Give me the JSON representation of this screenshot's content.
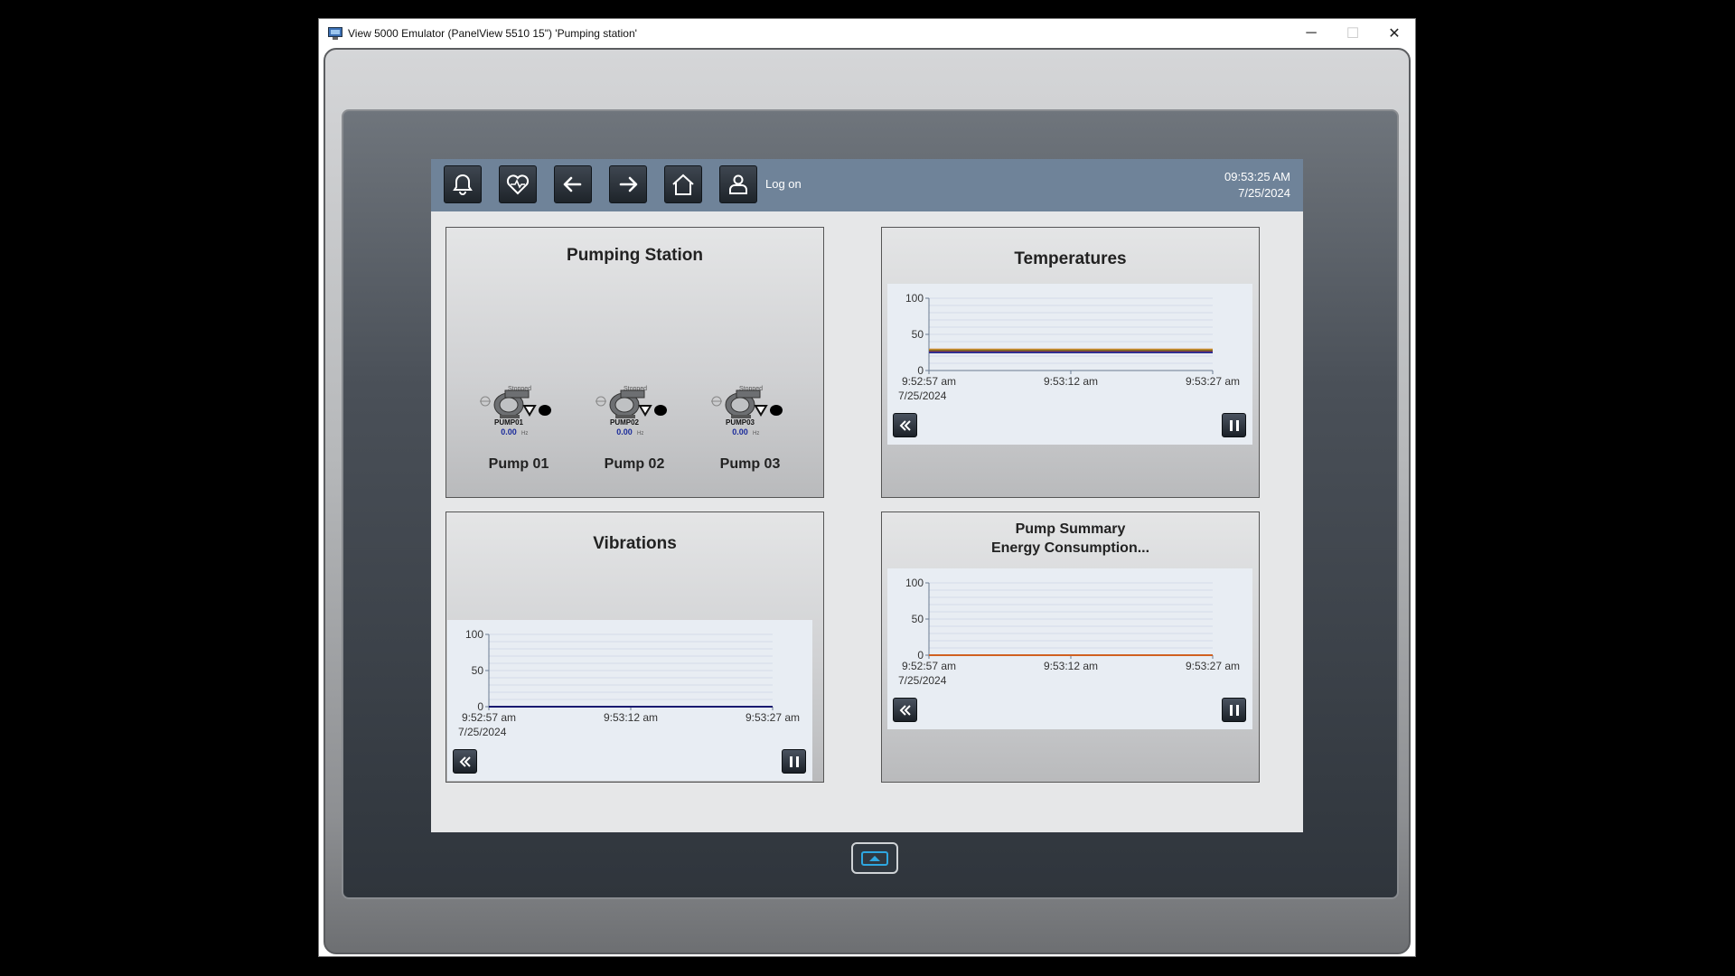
{
  "window": {
    "title": "View 5000 Emulator (PanelView 5510 15\") 'Pumping station'",
    "minimize_glyph": "─",
    "maximize_glyph": "☐",
    "close_glyph": "✕"
  },
  "navbar": {
    "buttons": [
      "bell-icon",
      "heartbeat-icon",
      "back-arrow-icon",
      "forward-arrow-icon",
      "home-icon",
      "user-icon"
    ],
    "logon_label": "Log on",
    "time": "09:53:25 AM",
    "date": "7/25/2024"
  },
  "pumping_station": {
    "title": "Pumping Station",
    "pumps": [
      {
        "tag": "PUMP01",
        "state": "Stopped",
        "freq": "0.00",
        "unit": "Hz",
        "label": "Pump 01"
      },
      {
        "tag": "PUMP02",
        "state": "Stopped",
        "freq": "0.00",
        "unit": "Hz",
        "label": "Pump 02"
      },
      {
        "tag": "PUMP03",
        "state": "Stopped",
        "freq": "0.00",
        "unit": "Hz",
        "label": "Pump 03"
      }
    ]
  },
  "temperatures": {
    "title": "Temperatures",
    "y_ticks": [
      "100",
      "50",
      "0"
    ],
    "x_ticks": [
      "9:52:57 am",
      "9:53:12 am",
      "9:53:27 am"
    ],
    "start_date": "7/25/2024"
  },
  "vibrations": {
    "title": "Vibrations",
    "y_ticks": [
      "100",
      "50",
      "0"
    ],
    "x_ticks": [
      "9:52:57 am",
      "9:53:12 am",
      "9:53:27 am"
    ],
    "start_date": "7/25/2024"
  },
  "energy": {
    "title_line1": "Pump Summary",
    "title_line2": "Energy Consumption...",
    "y_ticks": [
      "100",
      "50",
      "0"
    ],
    "x_ticks": [
      "9:52:57 am",
      "9:53:12 am",
      "9:53:27 am"
    ],
    "start_date": "7/25/2024"
  },
  "chart_data": [
    {
      "type": "line",
      "ylim": [
        0,
        100
      ],
      "x": [
        "9:52:57 am",
        "9:53:12 am",
        "9:53:27 am"
      ],
      "series": [
        {
          "color": "#d88a2a",
          "values": [
            29,
            29,
            29
          ]
        },
        {
          "color": "#2a6e2a",
          "values": [
            27,
            27,
            27
          ]
        },
        {
          "color": "#c03030",
          "values": [
            26,
            26,
            26
          ]
        },
        {
          "color": "#303090",
          "values": [
            25,
            25,
            25
          ]
        }
      ],
      "grid": true
    },
    {
      "type": "line",
      "ylim": [
        0,
        100
      ],
      "x": [
        "9:52:57 am",
        "9:53:12 am",
        "9:53:27 am"
      ],
      "series": [
        {
          "color": "#1a1a70",
          "values": [
            0,
            0,
            0
          ]
        }
      ],
      "grid": true
    },
    {
      "type": "line",
      "ylim": [
        0,
        100
      ],
      "x": [
        "9:52:57 am",
        "9:53:12 am",
        "9:53:27 am"
      ],
      "series": [
        {
          "color": "#d06020",
          "values": [
            0,
            0,
            0
          ]
        }
      ],
      "grid": true
    }
  ]
}
